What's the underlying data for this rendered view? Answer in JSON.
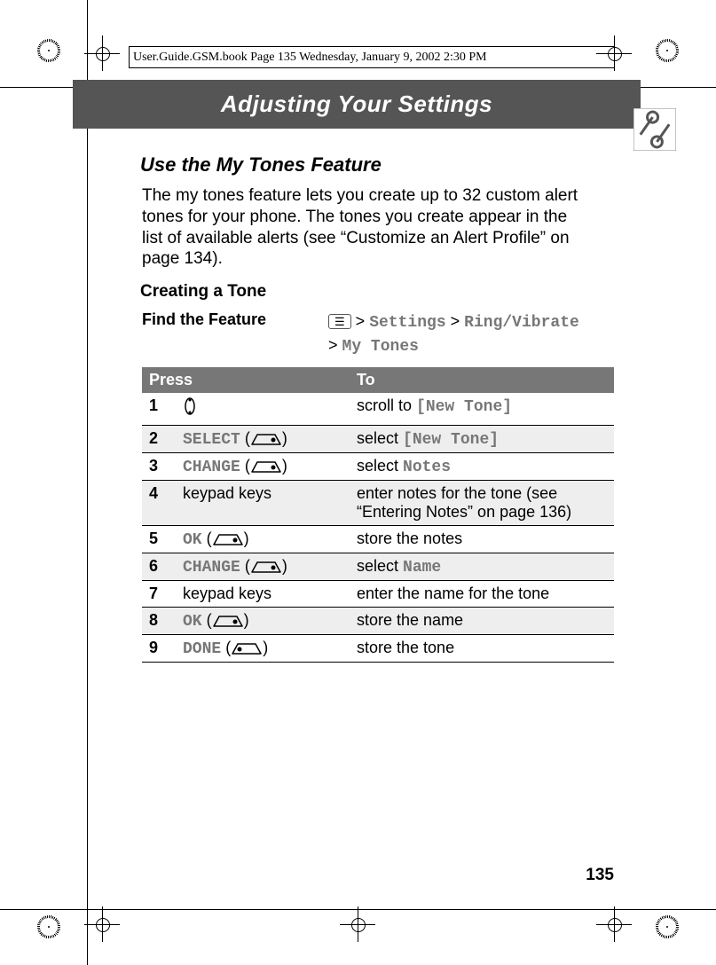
{
  "runhead": "User.Guide.GSM.book  Page 135  Wednesday, January 9, 2002  2:30 PM",
  "chapter_title": "Adjusting Your Settings",
  "section_title": "Use the My Tones Feature",
  "intro_para": "The my tones feature lets you create up to 32 custom alert tones for your phone. The tones you create appear in the list of available alerts (see “Customize an Alert Profile” on page 134).",
  "subsection_title": "Creating a Tone",
  "find_label": "Find the Feature",
  "nav_path": {
    "sep": ">",
    "item1": "Settings",
    "item2": "Ring/Vibrate",
    "item3": "My Tones"
  },
  "table": {
    "head_press": "Press",
    "head_to": "To",
    "rows": [
      {
        "n": "1",
        "press_type": "nav",
        "to_pre": "scroll to ",
        "to_mono": "[New Tone]",
        "to_post": ""
      },
      {
        "n": "2",
        "press_type": "soft",
        "press_label": "SELECT",
        "softside": "right",
        "to_pre": "select ",
        "to_mono": "[New Tone]",
        "to_post": ""
      },
      {
        "n": "3",
        "press_type": "soft",
        "press_label": "CHANGE",
        "softside": "right",
        "to_pre": "select ",
        "to_mono": "Notes",
        "to_post": ""
      },
      {
        "n": "4",
        "press_type": "text",
        "press_text": "keypad keys",
        "to_pre": "enter notes for the tone (see “Entering Notes” on page 136)",
        "to_mono": "",
        "to_post": ""
      },
      {
        "n": "5",
        "press_type": "soft",
        "press_label": "OK",
        "softside": "right",
        "to_pre": "store the notes",
        "to_mono": "",
        "to_post": ""
      },
      {
        "n": "6",
        "press_type": "soft",
        "press_label": "CHANGE",
        "softside": "right",
        "to_pre": "select ",
        "to_mono": "Name",
        "to_post": ""
      },
      {
        "n": "7",
        "press_type": "text",
        "press_text": "keypad keys",
        "to_pre": "enter the name for the tone",
        "to_mono": "",
        "to_post": ""
      },
      {
        "n": "8",
        "press_type": "soft",
        "press_label": "OK",
        "softside": "right",
        "to_pre": "store the name",
        "to_mono": "",
        "to_post": ""
      },
      {
        "n": "9",
        "press_type": "soft",
        "press_label": "DONE",
        "softside": "left",
        "to_pre": "store the tone",
        "to_mono": "",
        "to_post": ""
      }
    ]
  },
  "page_number": "135"
}
